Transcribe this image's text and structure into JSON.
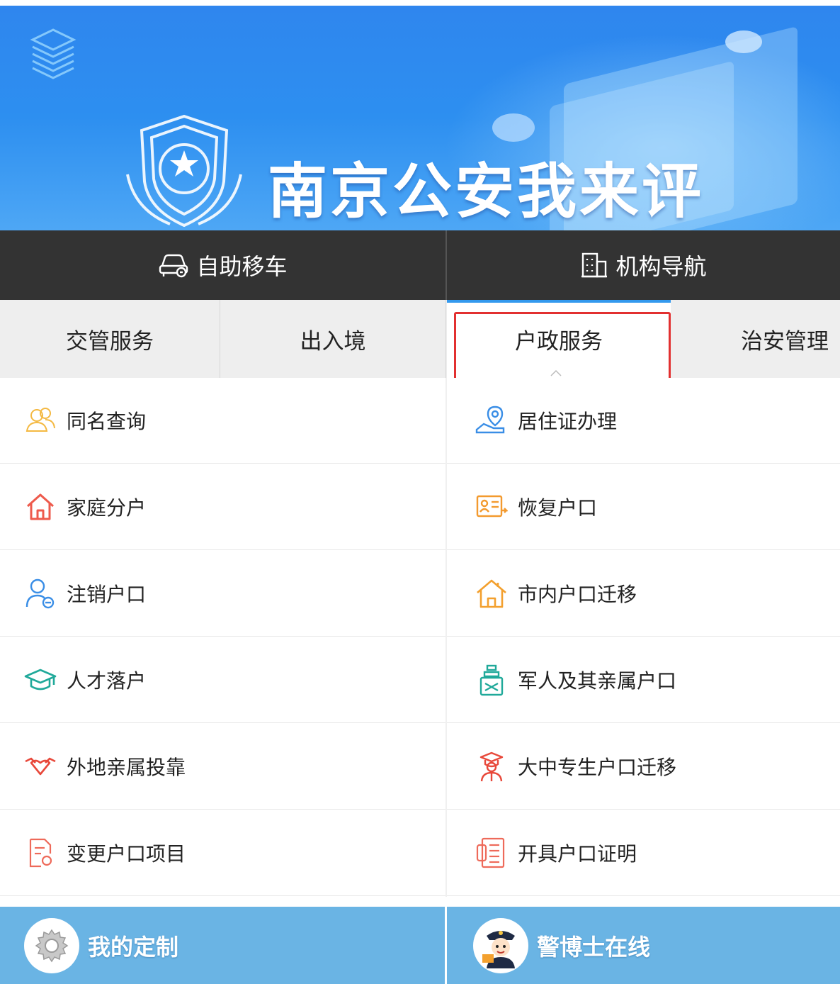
{
  "banner": {
    "title": "南京公安我来评"
  },
  "top_nav": {
    "left_label": "自助移车",
    "right_label": "机构导航"
  },
  "tabs": [
    {
      "label": "交管服务"
    },
    {
      "label": "出入境"
    },
    {
      "label": "户政服务",
      "active": true
    },
    {
      "label": "治安管理"
    }
  ],
  "services_left": [
    {
      "label": "同名查询",
      "icon": "people-icon"
    },
    {
      "label": "家庭分户",
      "icon": "house-icon"
    },
    {
      "label": "注销户口",
      "icon": "person-cancel-icon"
    },
    {
      "label": "人才落户",
      "icon": "graduation-cap-icon"
    },
    {
      "label": "外地亲属投靠",
      "icon": "handshake-icon"
    },
    {
      "label": "变更户口项目",
      "icon": "document-edit-icon"
    }
  ],
  "services_right": [
    {
      "label": "居住证办理",
      "icon": "location-hand-icon"
    },
    {
      "label": "恢复户口",
      "icon": "id-card-icon"
    },
    {
      "label": "市内户口迁移",
      "icon": "home-move-icon"
    },
    {
      "label": "军人及其亲属户口",
      "icon": "soldier-icon"
    },
    {
      "label": "大中专生户口迁移",
      "icon": "student-icon"
    },
    {
      "label": "开具户口证明",
      "icon": "certificate-icon"
    }
  ],
  "bottom_bar": {
    "left_label": "我的定制",
    "right_label": "警博士在线"
  },
  "colors": {
    "banner": "#2f86ee",
    "dark_nav": "#333333",
    "tab_active_underline": "#3399ee",
    "highlight": "#e23030",
    "bottom_bar": "#6ab4e4"
  }
}
